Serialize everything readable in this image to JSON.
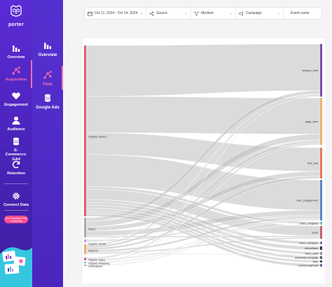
{
  "brand": {
    "name": "porter",
    "accent": "#ff6fb1",
    "sidebar_color": "#4a23b8"
  },
  "primary_nav": [
    {
      "label": "Overview",
      "icon": "bar-chart-icon"
    },
    {
      "label": "Acquisition",
      "icon": "flow-icon",
      "active": true
    },
    {
      "label": "Engagement",
      "icon": "heart-icon"
    },
    {
      "label": "Audience",
      "icon": "user-icon"
    },
    {
      "label": "E-Commerce: GA4",
      "icon": "coins-icon"
    },
    {
      "label": "Retention",
      "icon": "refresh-icon"
    },
    {
      "label": "Connect Data",
      "icon": "gear-icon"
    }
  ],
  "fb_pill": "Join Facebook Free Community",
  "secondary_nav": [
    {
      "label": "Overview",
      "icon": "bar-chart-icon"
    },
    {
      "label": "Flow",
      "icon": "flow-icon",
      "active": true
    },
    {
      "label": "Google Ads",
      "icon": "coins-icon"
    }
  ],
  "filters": {
    "date_range": "Oct 11, 2024 - Oct 14, 2024",
    "source": "Source",
    "medium": "Medium",
    "campaign": "Campaign",
    "event_name": "Event name"
  },
  "chart_data": {
    "type": "sankey",
    "sources": [
      {
        "name": "Organic Search",
        "color": "#d9626b"
      },
      {
        "name": "Direct",
        "color": "#aaaaaa"
      },
      {
        "name": "Organic Social",
        "color": "#c9a0d9"
      },
      {
        "name": "Referral",
        "color": "#e8b06a"
      },
      {
        "name": "Organic Video",
        "color": "#d46aa5"
      },
      {
        "name": "Organic Shopping",
        "color": "#77c1d6"
      },
      {
        "name": "Unassigned",
        "color": "#b89be0"
      }
    ],
    "targets": [
      {
        "name": "session_start",
        "color": "#7b4fa8"
      },
      {
        "name": "page_view",
        "color": "#f0b36e"
      },
      {
        "name": "first_visit",
        "color": "#e8795c"
      },
      {
        "name": "user_engagement",
        "color": "#5a87c8"
      },
      {
        "name": "video_progress",
        "color": "#6ec0b8"
      },
      {
        "name": "scroll",
        "color": "#c65f73"
      },
      {
        "name": "video_complete",
        "color": "#8f76c4"
      },
      {
        "name": "ActiveBase",
        "color": "#333344"
      },
      {
        "name": "video_start",
        "color": "#9a8ab8"
      },
      {
        "name": "download_template",
        "color": "#5b5b7a"
      },
      {
        "name": "click",
        "color": "#444458"
      },
      {
        "name": "License payment",
        "color": "#7a6aa0"
      }
    ]
  }
}
